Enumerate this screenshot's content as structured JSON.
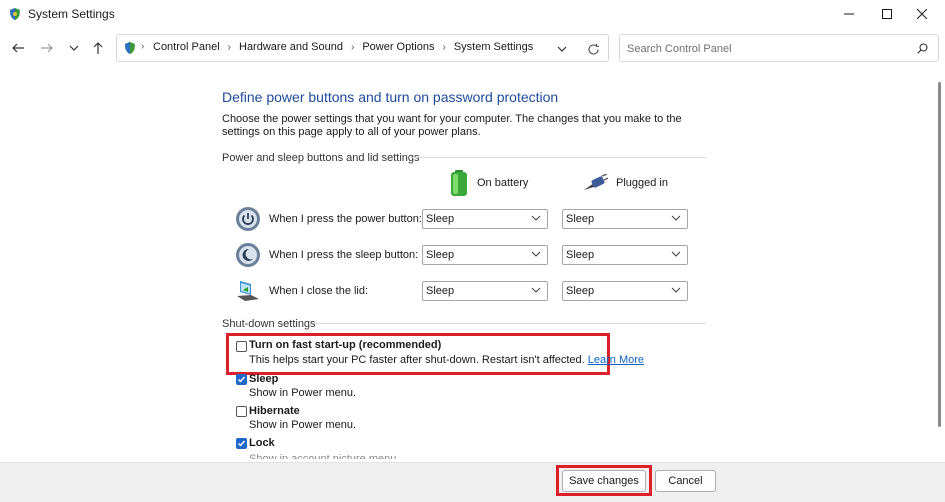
{
  "window": {
    "title": "System Settings",
    "icon": "power-options-shield-icon"
  },
  "nav": {
    "breadcrumbs": [
      "Control Panel",
      "Hardware and Sound",
      "Power Options",
      "System Settings"
    ],
    "search_placeholder": "Search Control Panel"
  },
  "page": {
    "heading": "Define power buttons and turn on password protection",
    "description": "Choose the power settings that you want for your computer. The changes that you make to the settings on this page apply to all of your power plans."
  },
  "power_section": {
    "title": "Power and sleep buttons and lid settings",
    "columns": {
      "battery": "On battery",
      "plugged": "Plugged in"
    },
    "rows": [
      {
        "label": "When I press the power button:",
        "battery": "Sleep",
        "plugged": "Sleep",
        "icon": "power-button-icon"
      },
      {
        "label": "When I press the sleep button:",
        "battery": "Sleep",
        "plugged": "Sleep",
        "icon": "sleep-button-icon"
      },
      {
        "label": "When I close the lid:",
        "battery": "Sleep",
        "plugged": "Sleep",
        "icon": "laptop-lid-icon"
      }
    ]
  },
  "shutdown_section": {
    "title": "Shut-down settings",
    "options": [
      {
        "label": "Turn on fast start-up (recommended)",
        "description": "This helps start your PC faster after shut-down. Restart isn't affected.",
        "link": "Learn More",
        "checked": false
      },
      {
        "label": "Sleep",
        "description": "Show in Power menu.",
        "checked": true
      },
      {
        "label": "Hibernate",
        "description": "Show in Power menu.",
        "checked": false
      },
      {
        "label": "Lock",
        "description": "Show in account picture menu.",
        "checked": true
      }
    ]
  },
  "footer": {
    "save": "Save changes",
    "cancel": "Cancel"
  },
  "colors": {
    "heading": "#1f4b9c",
    "highlight_box": "#d9202b",
    "checkbox_checked": "#1f66c9",
    "link": "#0b63c4"
  }
}
